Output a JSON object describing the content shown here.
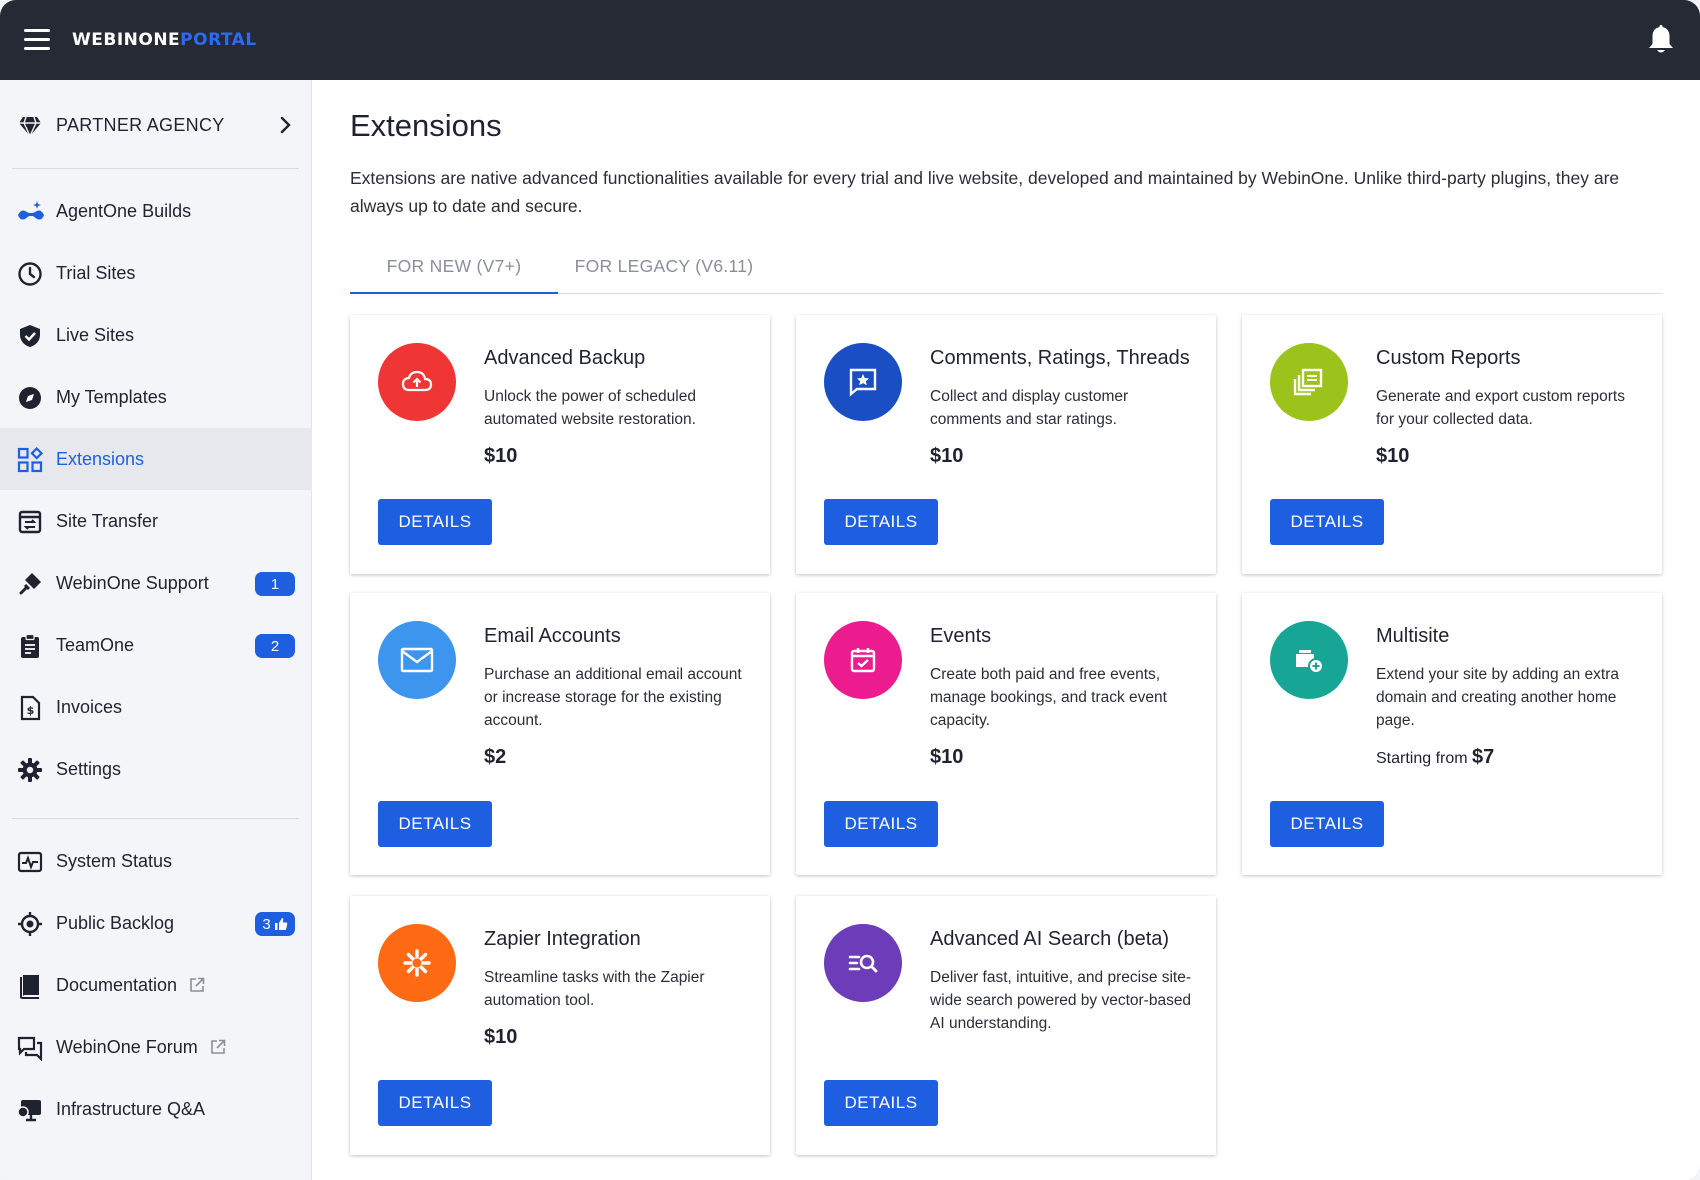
{
  "header": {
    "logo_primary": "WEBINONE",
    "logo_secondary": "PORTAL",
    "menu_icon": "hamburger-icon",
    "notification_icon": "bell-icon"
  },
  "sidebar": {
    "agency": {
      "label": "PARTNER AGENCY",
      "icon": "diamond-icon"
    },
    "items": [
      {
        "label": "AgentOne Builds",
        "icon": "agent-glasses-icon"
      },
      {
        "label": "Trial Sites",
        "icon": "clock-icon"
      },
      {
        "label": "Live Sites",
        "icon": "shield-check-icon"
      },
      {
        "label": "My Templates",
        "icon": "compass-icon"
      },
      {
        "label": "Extensions",
        "icon": "widgets-icon",
        "active": true
      },
      {
        "label": "Site Transfer",
        "icon": "transfer-icon"
      },
      {
        "label": "WebinOne Support",
        "icon": "plug-icon",
        "badge": "1"
      },
      {
        "label": "TeamOne",
        "icon": "clipboard-icon",
        "badge": "2"
      },
      {
        "label": "Invoices",
        "icon": "invoice-icon"
      },
      {
        "label": "Settings",
        "icon": "gear-icon"
      }
    ],
    "secondary_items": [
      {
        "label": "System Status",
        "icon": "pulse-icon"
      },
      {
        "label": "Public Backlog",
        "icon": "target-icon",
        "badge": "3"
      },
      {
        "label": "Documentation",
        "icon": "book-icon",
        "external": true
      },
      {
        "label": "WebinOne Forum",
        "icon": "forum-icon",
        "external": true
      },
      {
        "label": "Infrastructure Q&A",
        "icon": "monitor-chat-icon"
      }
    ]
  },
  "main": {
    "title": "Extensions",
    "description": "Extensions are native advanced functionalities available for every trial and live website, developed and maintained by WebinOne. Unlike third-party plugins, they are always up to date and secure.",
    "tabs": [
      {
        "label": "FOR NEW (V7+)",
        "active": true
      },
      {
        "label": "FOR LEGACY (V6.11)",
        "active": false
      }
    ],
    "cards": [
      {
        "title": "Advanced Backup",
        "description": "Unlock the power of scheduled automated website restoration.",
        "price_prefix": "",
        "price": "$10",
        "button": "DETAILS",
        "color": "#f03535",
        "icon": "cloud-upload-icon"
      },
      {
        "title": "Comments, Ratings, Threads",
        "description": "Collect and display customer comments and star ratings.",
        "price_prefix": "",
        "price": "$10",
        "button": "DETAILS",
        "color": "#1a4fc4",
        "icon": "star-comment-icon"
      },
      {
        "title": "Custom Reports",
        "description": "Generate and export custom reports for your collected data.",
        "price_prefix": "",
        "price": "$10",
        "button": "DETAILS",
        "color": "#9cc21c",
        "icon": "report-stack-icon"
      },
      {
        "title": "Email Accounts",
        "description": "Purchase an additional email account or increase storage for the existing account.",
        "price_prefix": "",
        "price": "$2",
        "button": "DETAILS",
        "color": "#3d95ee",
        "icon": "mail-icon"
      },
      {
        "title": "Events",
        "description": "Create both paid and free events, manage bookings, and track event capacity.",
        "price_prefix": "",
        "price": "$10",
        "button": "DETAILS",
        "color": "#ec1b8e",
        "icon": "calendar-check-icon"
      },
      {
        "title": "Multisite",
        "description": "Extend your site by adding an extra domain and creating another home page.",
        "price_prefix": "Starting from ",
        "price": "$7",
        "button": "DETAILS",
        "color": "#17a596",
        "icon": "add-site-icon"
      },
      {
        "title": "Zapier Integration",
        "description": "Streamline tasks with the Zapier automation tool.",
        "price_prefix": "",
        "price": "$10",
        "button": "DETAILS",
        "color": "#ff6a14",
        "icon": "zapier-asterisk-icon"
      },
      {
        "title": "Advanced AI Search (beta)",
        "description": "Deliver fast, intuitive, and precise site-wide search powered by vector-based AI understanding.",
        "price_prefix": "",
        "price": "",
        "button": "DETAILS",
        "color": "#6d3cb8",
        "icon": "ai-search-icon"
      }
    ]
  }
}
